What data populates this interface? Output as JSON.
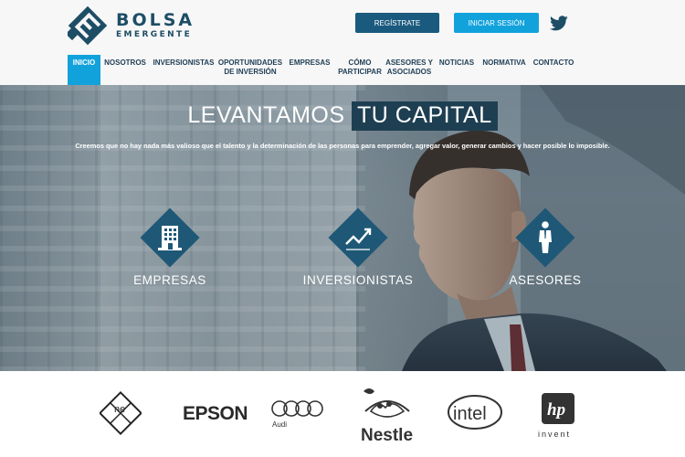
{
  "header": {
    "logo": {
      "line1": "BOLSA",
      "line2": "EMERGENTE"
    },
    "register_label": "REGÍSTRATE",
    "login_label": "INICIAR SESIÓN",
    "social_icon": "twitter-icon"
  },
  "nav": {
    "items": [
      {
        "line1": "INICIO",
        "line2": ""
      },
      {
        "line1": "NOSOTROS",
        "line2": ""
      },
      {
        "line1": "INVERSIONISTAS",
        "line2": ""
      },
      {
        "line1": "OPORTUNIDADES",
        "line2": "DE INVERSIÓN"
      },
      {
        "line1": "EMPRESAS",
        "line2": ""
      },
      {
        "line1": "CÓMO",
        "line2": "PARTICIPAR"
      },
      {
        "line1": "ASESORES Y",
        "line2": "ASOCIADOS"
      },
      {
        "line1": "NOTICIAS",
        "line2": ""
      },
      {
        "line1": "NORMATIVA",
        "line2": ""
      },
      {
        "line1": "CONTACTO",
        "line2": ""
      }
    ],
    "active": "INICIO"
  },
  "hero": {
    "headline_part1": "LEVANTAMOS ",
    "headline_part2": "TU CAPITAL",
    "tagline": "Creemos que no hay nada más valioso que el talento y la determinación de las personas para emprender, agregar valor, generar cambios y hacer posible lo imposible.",
    "features": [
      {
        "label": "EMPRESAS",
        "icon": "building-icon"
      },
      {
        "label": "INVERSIONISTAS",
        "icon": "chart-line-icon"
      },
      {
        "label": "ASESORES",
        "icon": "person-icon"
      }
    ]
  },
  "partners": {
    "logos": [
      {
        "name": "nexo",
        "text": "ne"
      },
      {
        "name": "epson",
        "text": "EPSON"
      },
      {
        "name": "audi",
        "text": "Audi"
      },
      {
        "name": "nestle",
        "text": "Nestle"
      },
      {
        "name": "intel",
        "text": "intel"
      },
      {
        "name": "hp",
        "text": "hp",
        "tagline": "invent"
      }
    ]
  },
  "colors": {
    "brand_dark": "#1e4d66",
    "accent_blue": "#11a2dc",
    "button_dark": "#1a5a7e",
    "diamond": "#1f5876"
  }
}
